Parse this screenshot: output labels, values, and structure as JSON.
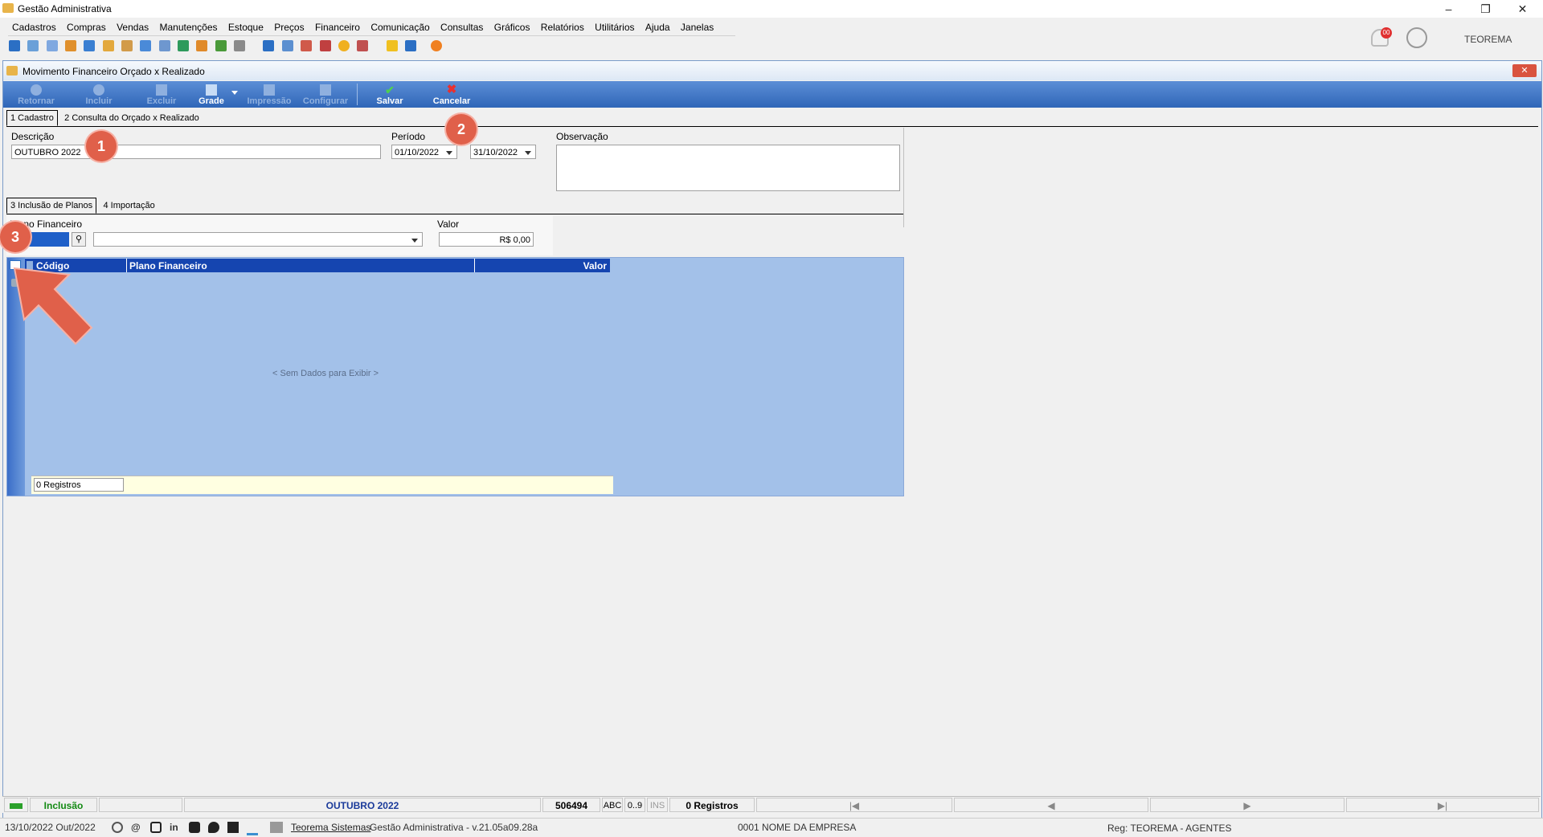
{
  "window": {
    "title": "Gestão Administrativa"
  },
  "menu": [
    "Cadastros",
    "Compras",
    "Vendas",
    "Manutenções",
    "Estoque",
    "Preços",
    "Financeiro",
    "Comunicação",
    "Consultas",
    "Gráficos",
    "Relatórios",
    "Utilitários",
    "Ajuda",
    "Janelas"
  ],
  "user": {
    "name": "TEOREMA",
    "notification_count": "00"
  },
  "doc": {
    "title": "Movimento Financeiro Orçado x Realizado",
    "ribbon": {
      "retornar": "Retornar",
      "incluir": "Incluir",
      "excluir": "Excluir",
      "grade": "Grade",
      "impressao": "Impressão",
      "configurar": "Configurar",
      "salvar": "Salvar",
      "cancelar": "Cancelar"
    },
    "tabs": {
      "cadastro": "1 Cadastro",
      "consulta": "2 Consulta do Orçado x Realizado"
    },
    "form": {
      "descricao_label": "Descrição",
      "descricao_value": "OUTUBRO 2022",
      "periodo_label": "Período",
      "periodo_start": "01/10/2022",
      "periodo_end": "31/10/2022",
      "observacao_label": "Observação"
    },
    "subtabs": {
      "inclusao": "3 Inclusão de Planos",
      "importacao": "4 Importação"
    },
    "entry": {
      "plano_label": "Plano Financeiro",
      "valor_label": "Valor",
      "valor_value": "R$ 0,00"
    },
    "grid": {
      "columns": [
        "Código",
        "Plano Financeiro",
        "Valor"
      ],
      "empty_text": "< Sem Dados para Exibir >",
      "footer_count": "0 Registros"
    },
    "badges": [
      "1",
      "2",
      "3"
    ]
  },
  "statusbar": {
    "mode": "Inclusão",
    "record_desc": "OUTUBRO 2022",
    "record_id": "506494",
    "abc": "ABC",
    "digits": "0..9",
    "ins": "INS",
    "count": "0 Registros"
  },
  "bottombar": {
    "date": "13/10/2022 Out/2022",
    "company_link": "Teorema Sistemas",
    "version": "Gestão Administrativa - v.21.05a09.28a",
    "empresa": "0001 NOME DA EMPRESA",
    "reg": "Reg: TEOREMA - AGENTES"
  }
}
